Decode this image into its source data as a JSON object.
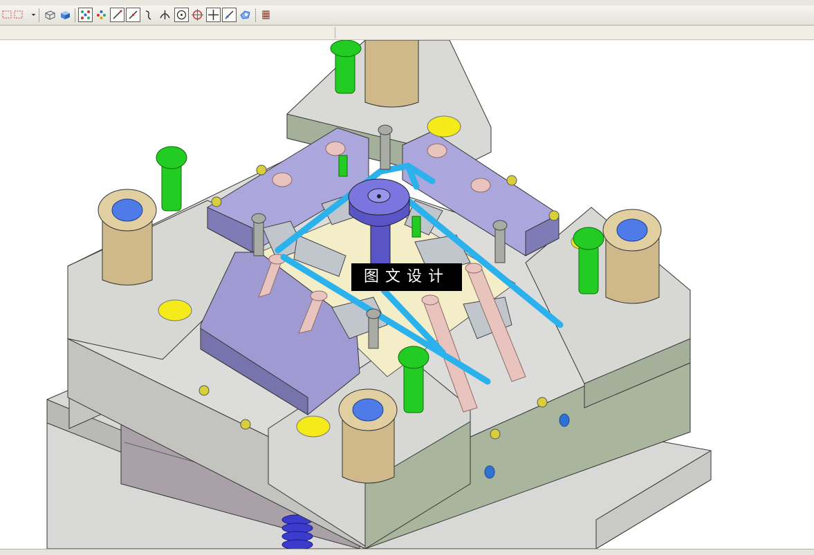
{
  "toolbar": {
    "tools": [
      {
        "icon": "select-box-icon"
      },
      {
        "icon": "dropdown-arrow-icon"
      },
      {
        "icon": "shaded-view-icon"
      },
      {
        "icon": "solid-cube-icon"
      },
      {
        "icon": "snap-points-icon"
      },
      {
        "icon": "snap-grid-icon"
      },
      {
        "icon": "line-snap-icon"
      },
      {
        "icon": "line-endpoint-icon"
      },
      {
        "icon": "curve-icon"
      },
      {
        "icon": "perpendicular-icon"
      },
      {
        "icon": "circle-center-icon"
      },
      {
        "icon": "circle-quadrant-icon"
      },
      {
        "icon": "crosshair-icon"
      },
      {
        "icon": "tangent-icon"
      },
      {
        "icon": "snap-settings-icon"
      },
      {
        "icon": "grid-toggle-icon"
      }
    ]
  },
  "viewport": {
    "model": "injection-mold-assembly",
    "colors": {
      "plate": "#d6d6d3",
      "plate_side": "#a3ae96",
      "cavity_insert": "#a7a3d8",
      "bushing": "#cfb98a",
      "bushing_bore": "#4f7be8",
      "cap_screw": "#22cc22",
      "cooling_line": "#2bb1ec",
      "ejector_pin": "#e9c4bf",
      "sprue_bushing": "#5a55c7",
      "marker": "#f5ea1a",
      "spring": "#3b3bcc"
    }
  },
  "watermark": {
    "text": "图文设计"
  }
}
